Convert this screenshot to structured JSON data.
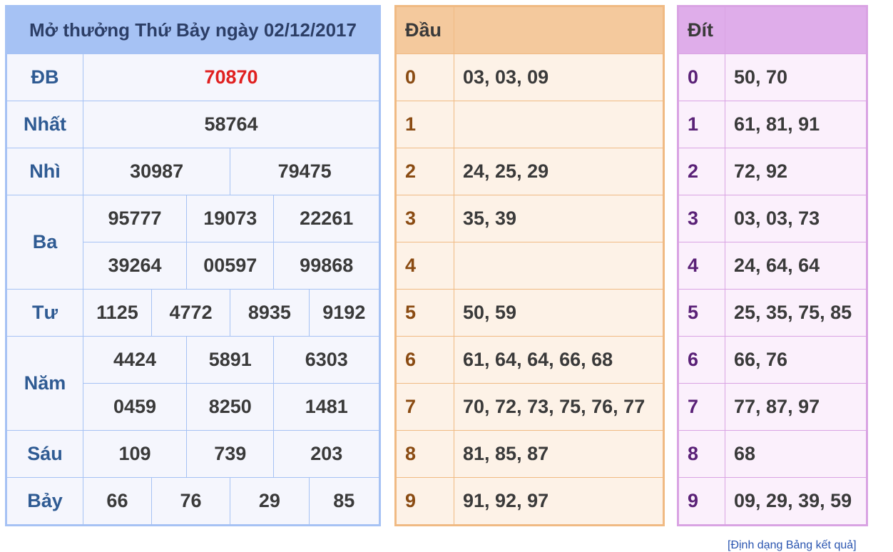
{
  "result": {
    "title": "Mở thưởng Thứ Bảy ngày 02/12/2017",
    "prizes": {
      "db": {
        "label": "ĐB",
        "values": [
          "70870"
        ]
      },
      "nhat": {
        "label": "Nhất",
        "values": [
          "58764"
        ]
      },
      "nhi": {
        "label": "Nhì",
        "values": [
          "30987",
          "79475"
        ]
      },
      "ba": {
        "label": "Ba",
        "values": [
          "95777",
          "19073",
          "22261",
          "39264",
          "00597",
          "99868"
        ]
      },
      "tu": {
        "label": "Tư",
        "values": [
          "1125",
          "4772",
          "8935",
          "9192"
        ]
      },
      "nam": {
        "label": "Năm",
        "values": [
          "4424",
          "5891",
          "6303",
          "0459",
          "8250",
          "1481"
        ]
      },
      "sau": {
        "label": "Sáu",
        "values": [
          "109",
          "739",
          "203"
        ]
      },
      "bay": {
        "label": "Bảy",
        "values": [
          "66",
          "76",
          "29",
          "85"
        ]
      }
    }
  },
  "dau": {
    "header": "Đầu",
    "rows": [
      {
        "key": "0",
        "value": "03, 03, 09"
      },
      {
        "key": "1",
        "value": ""
      },
      {
        "key": "2",
        "value": "24, 25, 29"
      },
      {
        "key": "3",
        "value": "35, 39"
      },
      {
        "key": "4",
        "value": ""
      },
      {
        "key": "5",
        "value": "50, 59"
      },
      {
        "key": "6",
        "value": "61, 64, 64, 66, 68"
      },
      {
        "key": "7",
        "value": "70, 72, 73, 75, 76, 77"
      },
      {
        "key": "8",
        "value": "81, 85, 87"
      },
      {
        "key": "9",
        "value": "91, 92, 97"
      }
    ]
  },
  "dit": {
    "header": "Đít",
    "rows": [
      {
        "key": "0",
        "value": "50, 70"
      },
      {
        "key": "1",
        "value": "61, 81, 91"
      },
      {
        "key": "2",
        "value": "72, 92"
      },
      {
        "key": "3",
        "value": "03, 03, 73"
      },
      {
        "key": "4",
        "value": "24, 64, 64"
      },
      {
        "key": "5",
        "value": "25, 35, 75, 85"
      },
      {
        "key": "6",
        "value": "66, 76"
      },
      {
        "key": "7",
        "value": "77, 87, 97"
      },
      {
        "key": "8",
        "value": "68"
      },
      {
        "key": "9",
        "value": "09, 29, 39, 59"
      }
    ]
  },
  "footer": {
    "link_text": "[Định dạng Bảng kết quả]"
  },
  "colors": {
    "result_border": "#a6c2f4",
    "dau_border": "#f0ba83",
    "dit_border": "#d9a3e3",
    "special_prize": "#e02020"
  }
}
